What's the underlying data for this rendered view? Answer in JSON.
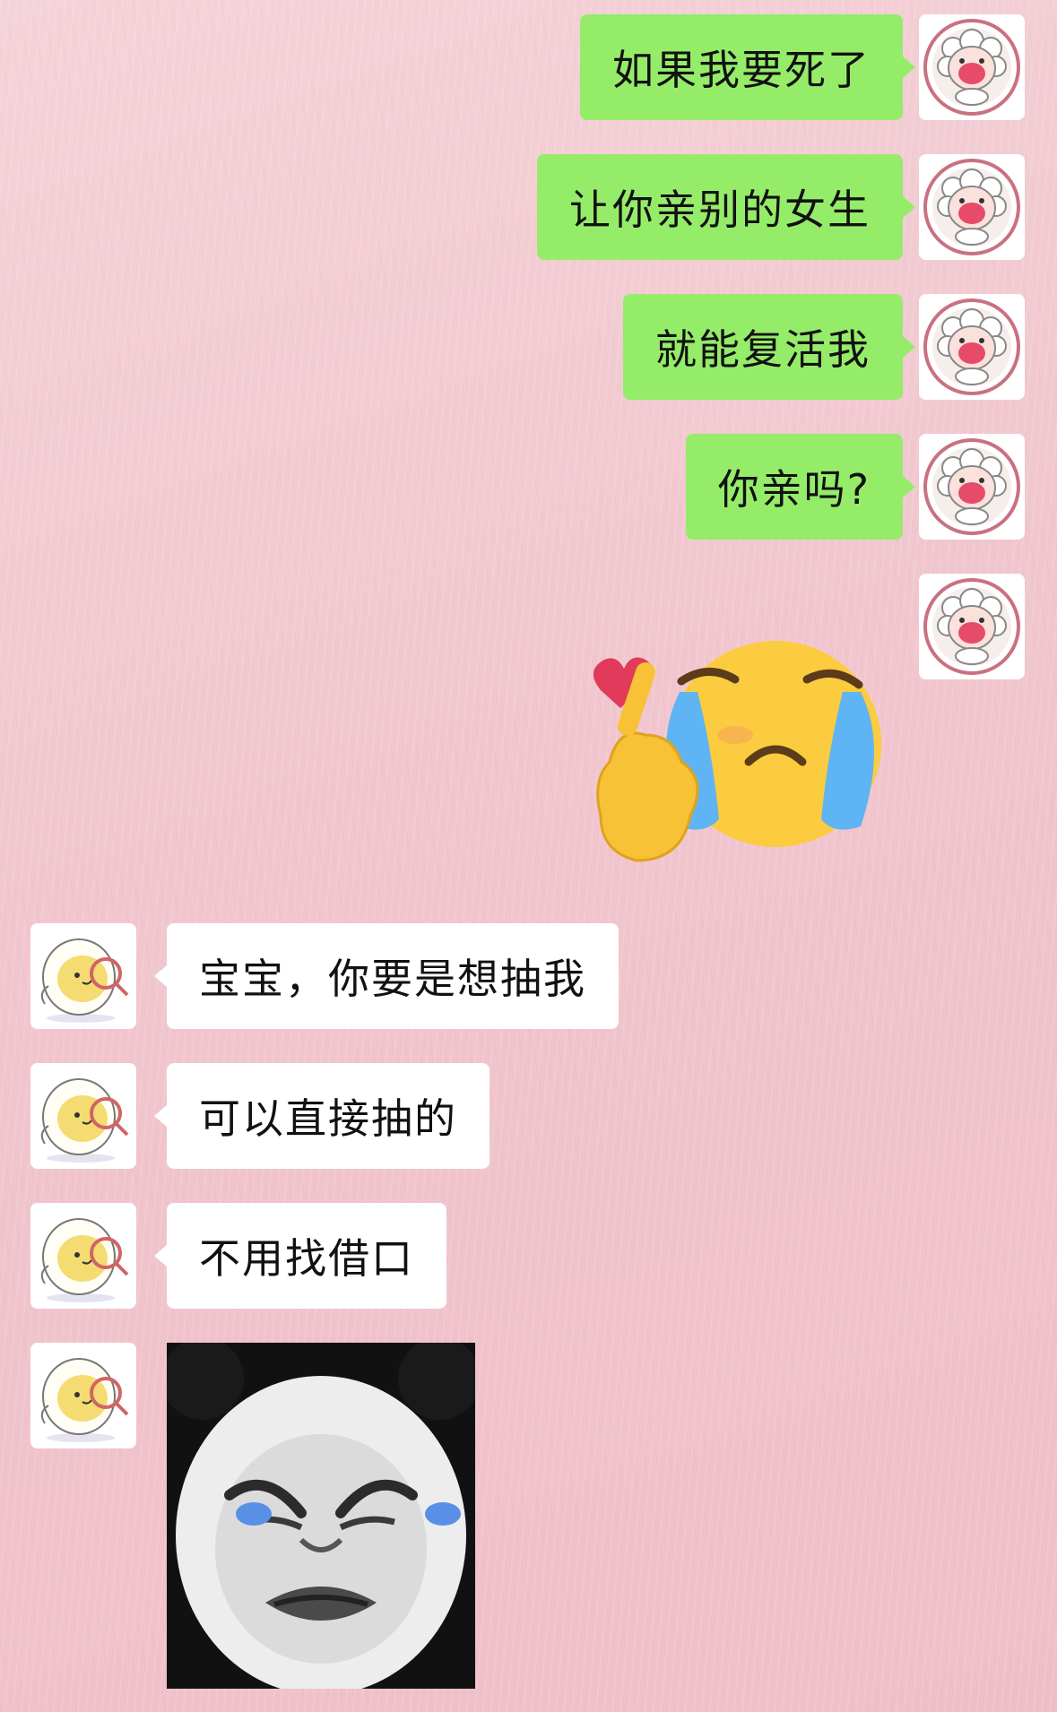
{
  "conversation": {
    "outgoing": [
      {
        "text": "如果我要死了"
      },
      {
        "text": "让你亲别的女生"
      },
      {
        "text": "就能复活我"
      },
      {
        "text": "你亲吗?"
      }
    ],
    "outgoing_sticker": {
      "icon": "crying-face-finger-heart-sticker"
    },
    "incoming": [
      {
        "text": "宝宝，你要是想抽我"
      },
      {
        "text": "可以直接抽的"
      },
      {
        "text": "不用找借口"
      }
    ],
    "incoming_sticker": {
      "icon": "crying-panda-face-sticker"
    }
  },
  "colors": {
    "outgoing_bubble": "#95ec69",
    "incoming_bubble": "#ffffff",
    "background": "#f1c6ce"
  },
  "avatars": {
    "self": {
      "icon": "sheep-avatar-icon"
    },
    "other": {
      "icon": "egg-chick-avatar-icon"
    }
  }
}
